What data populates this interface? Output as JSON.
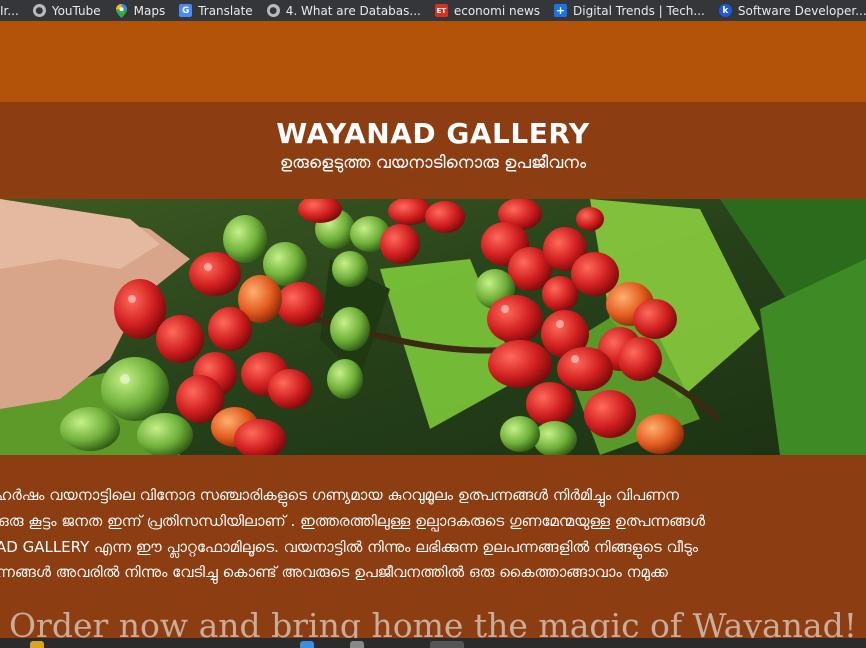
{
  "bookmarks": [
    {
      "label": "Ir...",
      "icon": "globe-icon"
    },
    {
      "label": "YouTube",
      "icon": "globe-icon"
    },
    {
      "label": "Maps",
      "icon": "maps-pin-icon"
    },
    {
      "label": "Translate",
      "icon": "translate-icon"
    },
    {
      "label": "4. What are Databas...",
      "icon": "globe-icon"
    },
    {
      "label": "economi news",
      "icon": "et-icon"
    },
    {
      "label": "Digital Trends | Tech...",
      "icon": "plus-icon"
    },
    {
      "label": "Software Developer...",
      "icon": "k-icon"
    }
  ],
  "header": {
    "title": "WAYANAD GALLERY",
    "subtitle": "ഉരുളെടുത്ത വയനാടിനൊരു ഉപജീവനം"
  },
  "hero": {
    "icon": "coffee-cherries-photo"
  },
  "description": {
    "lines": [
      "ഹർഷം വയനാട്ടിലെ വിനോദ സഞ്ചാരികളുടെ ഗണ്യമായ കുറവുമൂലം ഉത്പന്നങ്ങൾ നിർമിച്ചും വിപണന",
      "ഒരു കൂട്ടം ജനത ഇന്ന് പ്രതിസന്ധിയിലാണ് . ഇത്തരത്തിലുള്ള ഉല്പാദകരുടെ ഗുണമേന്മയുള്ള ഉത്പന്നങ്ങൾ",
      "AD GALLERY എന്ന ഈ പ്ലാറ്റഫോമിലൂടെ. വയനാട്ടിൽ നിന്നും ലഭിക്കുന്ന ഉലപന്നങ്ങളിൽ നിങ്ങളുടെ വീടും",
      "ന്നങ്ങൾ അവരിൽ നിന്നും വേടിച്ചു കൊണ്ട് അവരുടെ ഉപജീവനത്തിൽ ഒരു കൈത്താങ്ങാവാം നമുക്ക"
    ],
    "cta": "Order now and bring home the magic of Wayanad!"
  },
  "colors": {
    "bookmarks_bg": "#35363a",
    "top_band": "#b35209",
    "title_band": "#8c3d12",
    "text": "#ffffff",
    "cta_text": "#c9ad9a"
  }
}
